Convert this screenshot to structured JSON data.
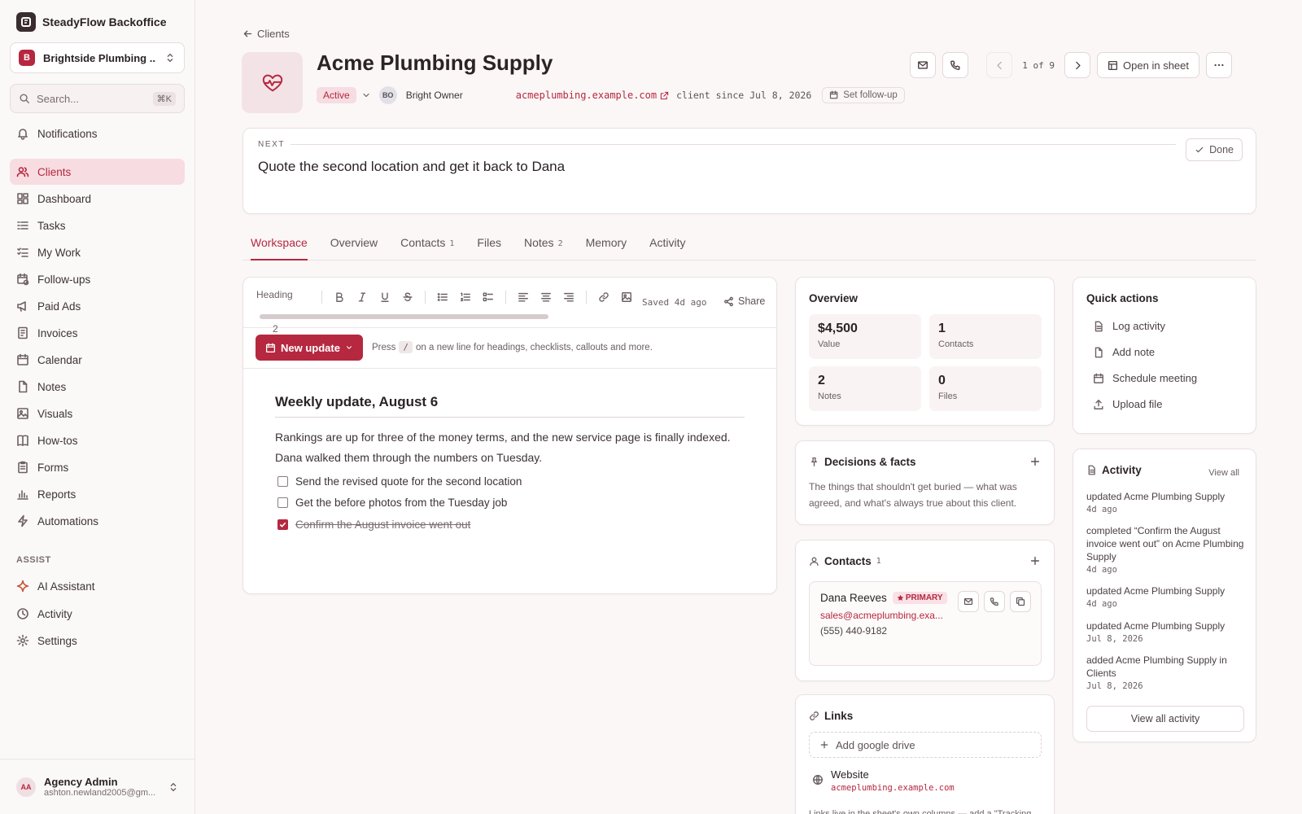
{
  "app": {
    "name": "SteadyFlow Backoffice"
  },
  "workspace": {
    "badge": "B",
    "name": "Brightside Plumbing ..."
  },
  "search": {
    "placeholder": "Search...",
    "shortcut": "⌘K"
  },
  "nav": {
    "notifications": "Notifications",
    "items": [
      "Clients",
      "Dashboard",
      "Tasks",
      "My Work",
      "Follow-ups",
      "Paid Ads",
      "Invoices",
      "Calendar",
      "Notes",
      "Visuals",
      "How-tos",
      "Forms",
      "Reports",
      "Automations"
    ],
    "active": "Clients",
    "assist_label": "ASSIST",
    "assist": [
      "AI Assistant",
      "Activity",
      "Settings"
    ]
  },
  "user": {
    "initials": "AA",
    "name": "Agency Admin",
    "email": "ashton.newland2005@gm..."
  },
  "breadcrumb": {
    "back": "Clients"
  },
  "client": {
    "name": "Acme Plumbing Supply",
    "status": "Active",
    "owner_initials": "BO",
    "owner": "Bright Owner",
    "website": "acmeplumbing.example.com",
    "since": "client since Jul 8, 2026",
    "followup": "Set follow-up"
  },
  "pager": {
    "text": "1 of 9"
  },
  "actions": {
    "open_sheet": "Open in sheet"
  },
  "next": {
    "label": "NEXT",
    "text": "Quote the second location and get it back to Dana",
    "done": "Done"
  },
  "tabs": [
    {
      "label": "Workspace",
      "count": ""
    },
    {
      "label": "Overview",
      "count": ""
    },
    {
      "label": "Contacts",
      "count": "1"
    },
    {
      "label": "Files",
      "count": ""
    },
    {
      "label": "Notes",
      "count": "2"
    },
    {
      "label": "Memory",
      "count": ""
    },
    {
      "label": "Activity",
      "count": ""
    }
  ],
  "editor": {
    "heading_select_1": "Heading",
    "heading_select_2": "2",
    "saved": "Saved 4d ago",
    "share": "Share",
    "new_update": "New update",
    "hint_before": "Press",
    "hint_key": "/",
    "hint_after": "on a new line for headings, checklists, callouts and more.",
    "doc_heading": "Weekly update, August 6",
    "doc_paragraph": "Rankings are up for three of the money terms, and the new service page is finally indexed. Dana walked them through the numbers on Tuesday.",
    "checklist": [
      {
        "text": "Send the revised quote for the second location",
        "checked": false
      },
      {
        "text": "Get the before photos from the Tuesday job",
        "checked": false
      },
      {
        "text": "Confirm the August invoice went out",
        "checked": true
      }
    ]
  },
  "overview": {
    "title": "Overview",
    "stats": [
      {
        "value": "$4,500",
        "label": "Value"
      },
      {
        "value": "1",
        "label": "Contacts"
      },
      {
        "value": "2",
        "label": "Notes"
      },
      {
        "value": "0",
        "label": "Files"
      }
    ]
  },
  "decisions": {
    "title": "Decisions & facts",
    "text": "The things that shouldn't get buried — what was agreed, and what's always true about this client."
  },
  "contacts": {
    "title": "Contacts",
    "count": "1",
    "name": "Dana Reeves",
    "badge": "PRIMARY",
    "email": "sales@acmeplumbing.exa...",
    "phone": "(555) 440-9182"
  },
  "links": {
    "title": "Links",
    "add_drive": "Add google drive",
    "website_label": "Website",
    "website_url": "acmeplumbing.example.com",
    "footer": "Links live in the sheet's own columns — add a \"Tracking"
  },
  "quick_actions": {
    "title": "Quick actions",
    "items": [
      "Log activity",
      "Add note",
      "Schedule meeting",
      "Upload file"
    ]
  },
  "activity": {
    "title": "Activity",
    "view_all": "View all",
    "items": [
      {
        "text": "updated Acme Plumbing Supply",
        "date": "4d ago"
      },
      {
        "text": "completed “Confirm the August invoice went out” on Acme Plumbing Supply",
        "date": "4d ago"
      },
      {
        "text": "updated Acme Plumbing Supply",
        "date": "4d ago"
      },
      {
        "text": "updated Acme Plumbing Supply",
        "date": "Jul 8, 2026"
      },
      {
        "text": "added Acme Plumbing Supply in Clients",
        "date": "Jul 8, 2026"
      }
    ],
    "view_all_button": "View all activity"
  },
  "colors": {
    "accent": "#b5283f",
    "accent_soft": "#f7dce1",
    "background": "#fbf7f7"
  }
}
